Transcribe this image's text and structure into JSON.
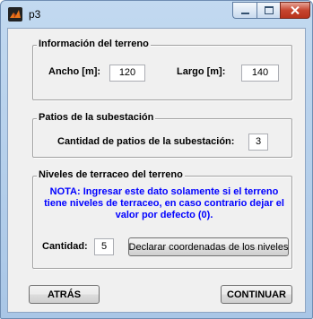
{
  "window": {
    "title": "p3",
    "minimize_icon": "minimize-icon",
    "maximize_icon": "maximize-icon",
    "close_icon": "close-icon"
  },
  "terreno": {
    "title": "Información del terreno",
    "ancho_label": "Ancho [m]:",
    "ancho_value": "120",
    "largo_label": "Largo [m]:",
    "largo_value": "140"
  },
  "patios": {
    "title": "Patios de la subestación",
    "cantidad_label": "Cantidad de patios de la subestación:",
    "cantidad_value": "3"
  },
  "niveles": {
    "title": "Niveles de terraceo del terreno",
    "note": "NOTA: Ingresar este dato solamente si el terreno tiene niveles de terraceo, en caso contrario dejar el valor por defecto (0).",
    "cantidad_label": "Cantidad:",
    "cantidad_value": "5",
    "declarar_button": "Declarar coordenadas de los niveles"
  },
  "footer": {
    "back_button": "ATRÁS",
    "continue_button": "CONTINUAR"
  },
  "colors": {
    "note_text": "#0000ff",
    "close_button": "#c6452f"
  }
}
